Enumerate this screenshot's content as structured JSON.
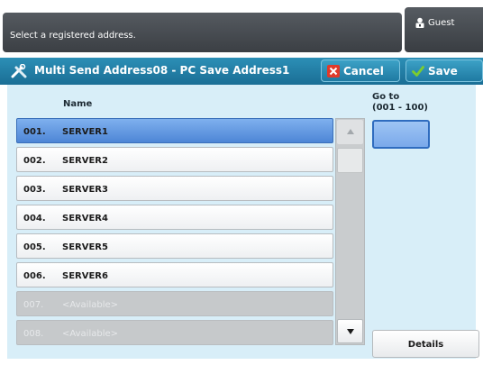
{
  "header": {
    "message": "Select a registered address.",
    "user_label": "Guest",
    "user_icon": "person-lock-icon"
  },
  "titlebar": {
    "title": "Multi Send Address08 - PC Save Address1",
    "icon": "tools-icon",
    "cancel_label": "Cancel",
    "save_label": "Save"
  },
  "list": {
    "column_header": "Name",
    "rows": [
      {
        "num": "001.",
        "name": "SERVER1",
        "state": "selected"
      },
      {
        "num": "002.",
        "name": "SERVER2",
        "state": "normal"
      },
      {
        "num": "003.",
        "name": "SERVER3",
        "state": "normal"
      },
      {
        "num": "004.",
        "name": "SERVER4",
        "state": "normal"
      },
      {
        "num": "005.",
        "name": "SERVER5",
        "state": "normal"
      },
      {
        "num": "006.",
        "name": "SERVER6",
        "state": "normal"
      },
      {
        "num": "007.",
        "name": "<Available>",
        "state": "available"
      },
      {
        "num": "008.",
        "name": "<Available>",
        "state": "available"
      }
    ]
  },
  "goto": {
    "label_line1": "Go to",
    "label_line2": "(001 - 100)",
    "value": ""
  },
  "details_label": "Details",
  "colors": {
    "titlebar": "#1a6e95",
    "selected_row": "#4d86d6",
    "panel": "#d8eef8",
    "cancel_icon": "#e03a2a",
    "save_icon": "#7ccc2e"
  }
}
